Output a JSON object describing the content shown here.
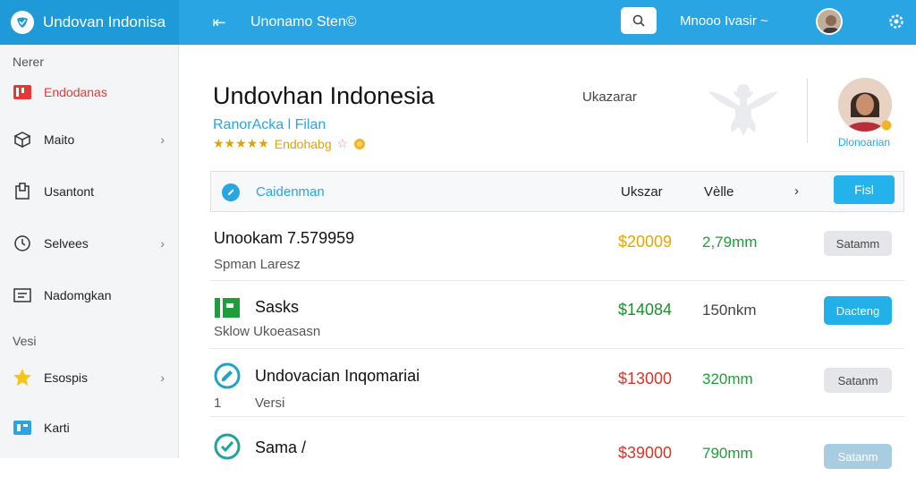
{
  "app": {
    "brand_title": "Undovan Indonisa",
    "top_title": "Unonamo Sten©",
    "user_name": "Mnooo Ivasir ~"
  },
  "sidebar": {
    "section_main": "Nerer",
    "section_secondary": "Vesi",
    "items": [
      {
        "label": "Endodanas",
        "icon": "flag-icon",
        "has_chevron": false
      },
      {
        "label": "Maito",
        "icon": "box-icon",
        "has_chevron": true
      },
      {
        "label": "Usantont",
        "icon": "document-icon",
        "has_chevron": false
      },
      {
        "label": "Selvees",
        "icon": "clock-icon",
        "has_chevron": true
      },
      {
        "label": "Nadomgkan",
        "icon": "folder-icon",
        "has_chevron": false
      },
      {
        "label": "Esospis",
        "icon": "star-icon",
        "has_chevron": true
      },
      {
        "label": "Karti",
        "icon": "card-icon",
        "has_chevron": false
      }
    ]
  },
  "header": {
    "title": "Undovhan Indonesia",
    "subtitle": "RanorAcka l Filan",
    "rating_stars": "★★★★★",
    "rating_label": "Endohabg",
    "rating_extra": "☆",
    "column_label": "Ukazarar",
    "profile_caption": "Dlonoarian"
  },
  "table": {
    "title": "Caidenman",
    "col1": "Ukszar",
    "col2": "Vèlle",
    "action_label": "Fisl",
    "rows": [
      {
        "title": "Unookam 7.579959",
        "subtitle": "Spman Laresz",
        "price": "$20009",
        "price_color": "#e4a600",
        "metric": "2,79mm",
        "metric_color": "#1f9d3a",
        "action": "Satamm",
        "action_style": "grey",
        "icon": "none-icon"
      },
      {
        "title": "Sasks",
        "subtitle": "Sklow Ukoeasasn",
        "price": "$14084",
        "price_color": "#1f8f2e",
        "metric": "150nkm",
        "metric_color": "#444444",
        "action": "Dacteng",
        "action_style": "blue",
        "icon": "green-block-icon"
      },
      {
        "title": "Undovacian Inqomariai",
        "subtitle": "Versi",
        "subtitle_prefix": "1",
        "price": "$13000",
        "price_color": "#d2372b",
        "metric": "320mm",
        "metric_color": "#1f9d3a",
        "action": "Satanm",
        "action_style": "grey",
        "icon": "pencil-circle-icon"
      },
      {
        "title": "Sama /",
        "subtitle": "",
        "price": "$39000",
        "price_color": "#d2372b",
        "metric": "790mm",
        "metric_color": "#1f9d3a",
        "action": "Satanm",
        "action_style": "blue-grey",
        "icon": "check-circle-icon"
      }
    ]
  },
  "colors": {
    "accent": "#2aa5e4",
    "button_blue": "#22b0e8",
    "sidebar_bg": "#f4f5f7"
  }
}
